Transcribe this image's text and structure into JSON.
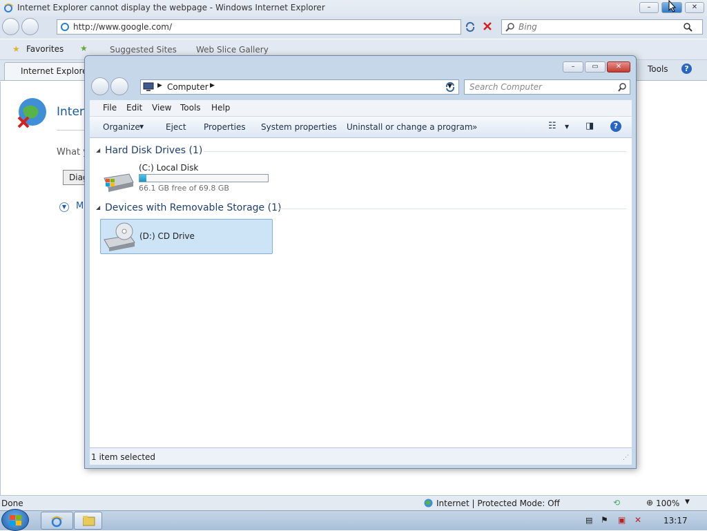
{
  "ie": {
    "window_title": "Internet Explorer cannot display the webpage - Windows Internet Explorer",
    "address": "http://www.google.com/",
    "search_placeholder": "Bing",
    "favorites_label": "Favorites",
    "suggested_sites": "Suggested Sites",
    "web_slice_gallery": "Web Slice Gallery",
    "tab_label": "Internet Explorer c",
    "tools_label": "Tools",
    "content_heading": "Intern",
    "content_line": "What y",
    "content_button": "Diag",
    "content_more": "M",
    "status_text": "Done",
    "zone_text": "Internet | Protected Mode: Off",
    "zoom": "100%"
  },
  "explorer": {
    "breadcrumb": "Computer",
    "search_placeholder": "Search Computer",
    "menu": [
      "File",
      "Edit",
      "View",
      "Tools",
      "Help"
    ],
    "commands": [
      "Organize",
      "Eject",
      "Properties",
      "System properties",
      "Uninstall or change a program"
    ],
    "more_chevron": "»",
    "groups": [
      {
        "title": "Hard Disk Drives (1)",
        "items": [
          {
            "name": "(C:) Local Disk",
            "detail": "66.1 GB free of 69.8 GB",
            "used_fraction": 0.053
          }
        ]
      },
      {
        "title": "Devices with Removable Storage (1)",
        "items": [
          {
            "name": "(D:) CD Drive"
          }
        ]
      }
    ],
    "status": "1 item selected"
  },
  "taskbar": {
    "clock": "13:17"
  }
}
